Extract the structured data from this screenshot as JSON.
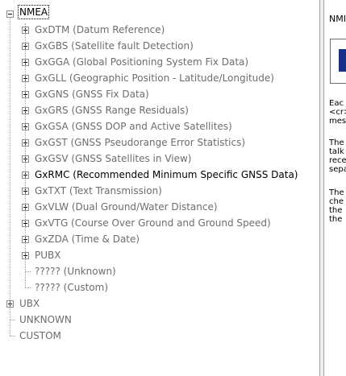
{
  "tree": {
    "root": {
      "label": "NMEA"
    },
    "nmea_children": [
      {
        "label": "GxDTM (Datum Reference)",
        "active": false,
        "expandable": true
      },
      {
        "label": "GxGBS (Satellite fault Detection)",
        "active": false,
        "expandable": true
      },
      {
        "label": "GxGGA (Global Positioning System Fix Data)",
        "active": false,
        "expandable": true
      },
      {
        "label": "GxGLL (Geographic Position - Latitude/Longitude)",
        "active": false,
        "expandable": true
      },
      {
        "label": "GxGNS (GNSS Fix Data)",
        "active": false,
        "expandable": true
      },
      {
        "label": "GxGRS (GNSS Range Residuals)",
        "active": false,
        "expandable": true
      },
      {
        "label": "GxGSA (GNSS DOP and Active Satellites)",
        "active": false,
        "expandable": true
      },
      {
        "label": "GxGST (GNSS Pseudorange Error Statistics)",
        "active": false,
        "expandable": true
      },
      {
        "label": "GxGSV (GNSS Satellites in View)",
        "active": false,
        "expandable": true
      },
      {
        "label": "GxRMC (Recommended Minimum Specific GNSS Data)",
        "active": true,
        "expandable": true
      },
      {
        "label": "GxTXT (Text Transmission)",
        "active": false,
        "expandable": true
      },
      {
        "label": "GxVLW (Dual Ground/Water Distance)",
        "active": false,
        "expandable": true
      },
      {
        "label": "GxVTG (Course Over Ground and Ground Speed)",
        "active": false,
        "expandable": true
      },
      {
        "label": "GxZDA (Time & Date)",
        "active": false,
        "expandable": true
      },
      {
        "label": "PUBX",
        "active": false,
        "expandable": true
      },
      {
        "label": "????? (Unknown)",
        "active": false,
        "expandable": false
      },
      {
        "label": "????? (Custom)",
        "active": false,
        "expandable": false
      }
    ],
    "other_roots": [
      {
        "label": "UBX",
        "expandable": true
      },
      {
        "label": "UNKNOWN",
        "expandable": false
      },
      {
        "label": "CUSTOM",
        "expandable": false
      }
    ]
  },
  "info_pane": {
    "heading": "NMI",
    "paragraph1": [
      "Eac",
      "<cr>",
      "mes"
    ],
    "paragraph2": [
      "The",
      "talk",
      "rece",
      "sepa"
    ],
    "paragraph3": [
      "The",
      "che",
      "the",
      "the"
    ]
  },
  "colors": {
    "inactive_text": "#6d6d6d",
    "active_text": "#000000",
    "tree_lines": "#a0a0a0"
  },
  "icons": {
    "expand": "plus-box-icon",
    "collapse": "minus-box-icon"
  }
}
